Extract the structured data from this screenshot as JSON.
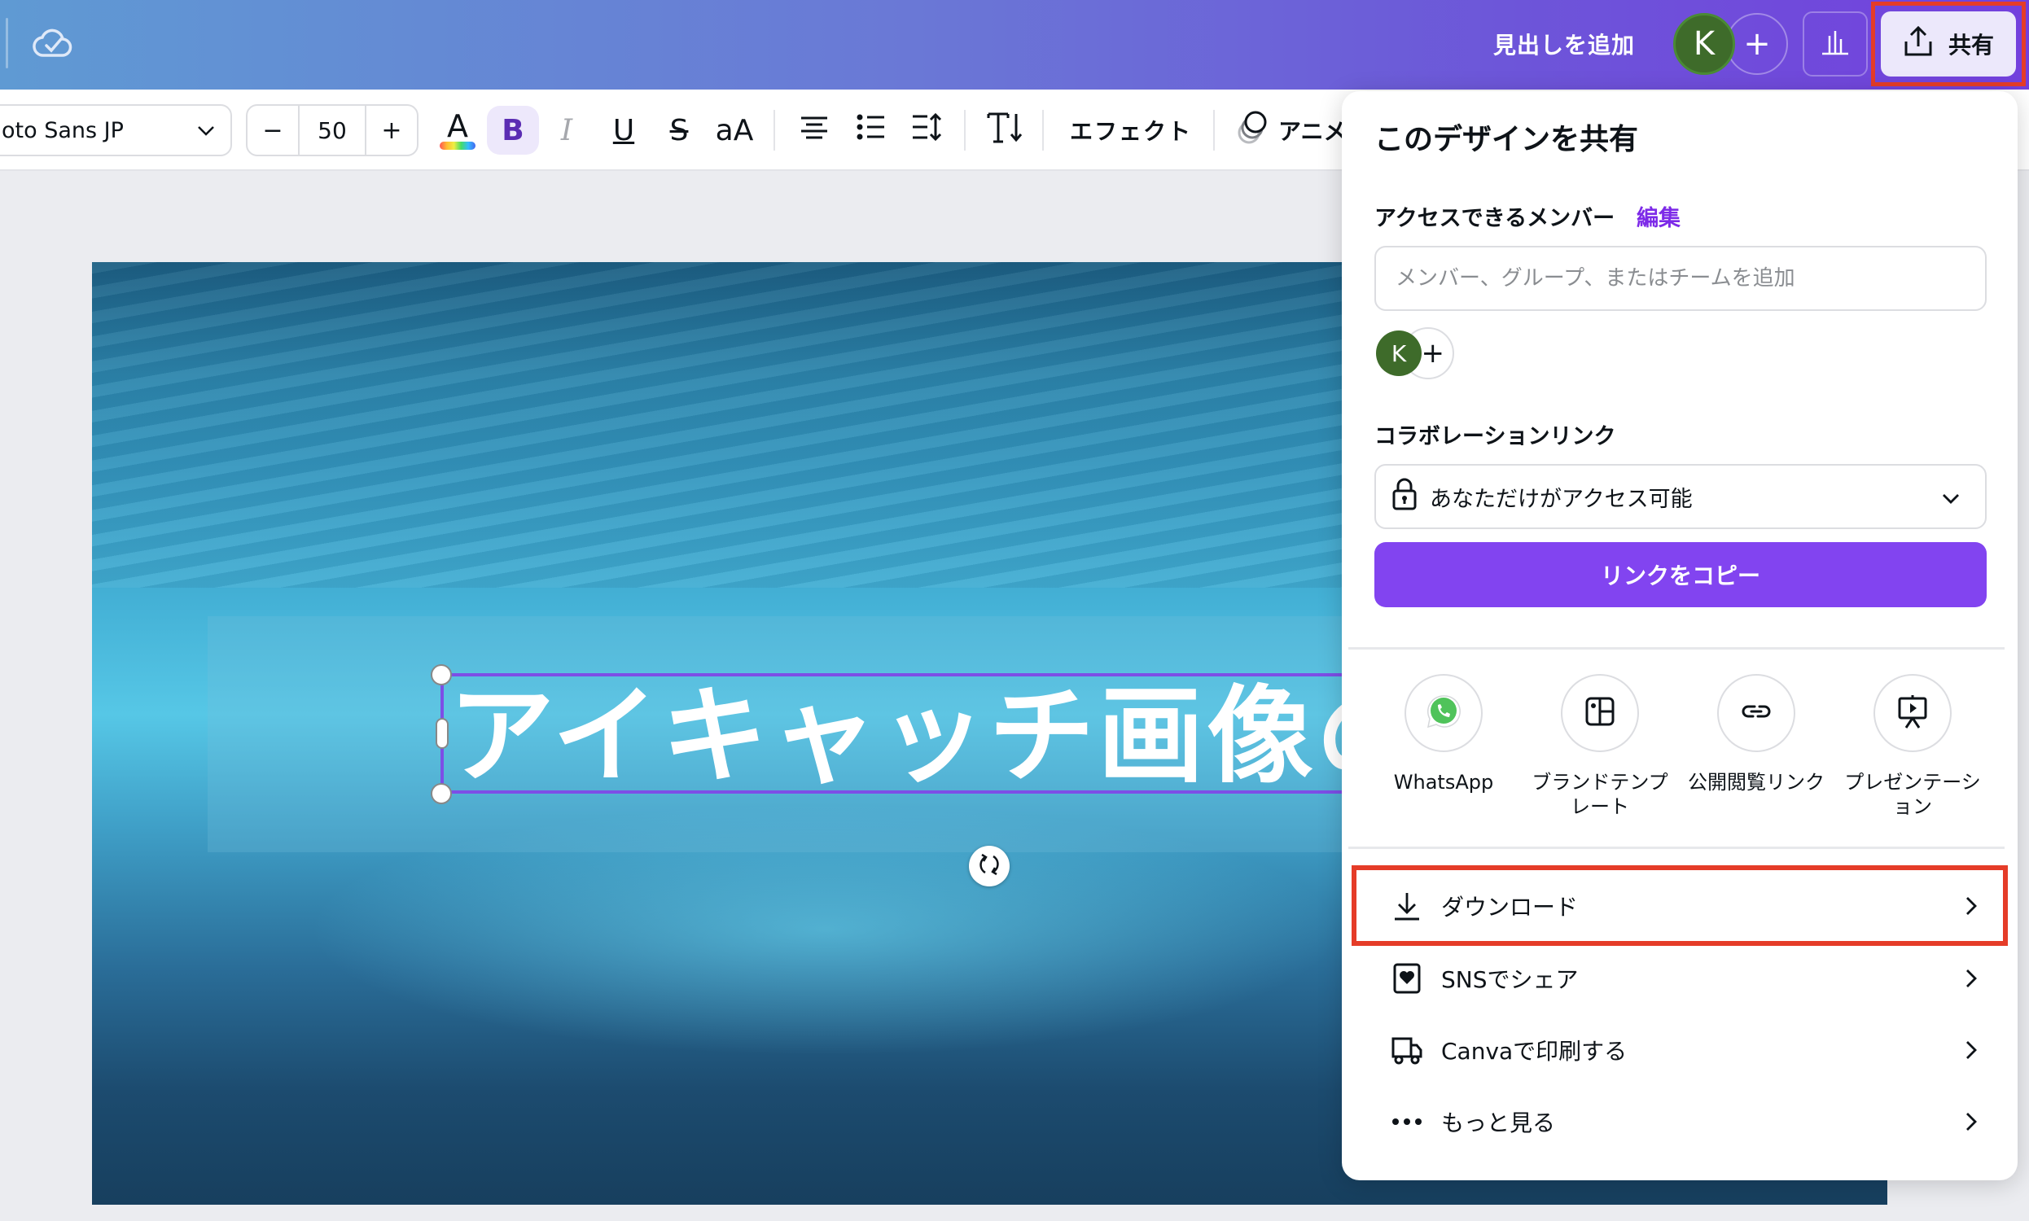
{
  "topbar": {
    "cloud_icon": "cloud-check-icon",
    "add_heading_label": "見出しを追加",
    "avatar_initial": "K",
    "invite_label": "+",
    "insights_icon": "bar-chart-icon",
    "share_label": "共有",
    "colors": {
      "gradient_start": "#5f9ad3",
      "gradient_end": "#7340dd",
      "highlight": "#e53c28"
    }
  },
  "toolbar": {
    "font_name": "Noto Sans JP",
    "font_name_visible": "oto Sans JP",
    "size_decrease": "−",
    "font_size": "50",
    "size_increase": "+",
    "text_color_label": "A",
    "bold_label": "B",
    "italic_label": "I",
    "underline_label": "U",
    "strike_label": "S",
    "case_label": "aA",
    "effects_label": "エフェクト",
    "animate_label": "アニメ"
  },
  "canvas": {
    "headline": "アイキャッチ画像の"
  },
  "share_panel": {
    "title": "このデザインを共有",
    "members_label": "アクセスできるメンバー",
    "edit_link": "編集",
    "member_input_placeholder": "メンバー、グループ、またはチームを追加",
    "member_input_value": "",
    "member_avatar_initial": "K",
    "add_member_label": "+",
    "collab_link_label": "コラボレーションリンク",
    "access_option": "あなただけがアクセス可能",
    "copy_link_label": "リンクをコピー",
    "share_options": [
      {
        "icon": "whatsapp-icon",
        "label": "WhatsApp"
      },
      {
        "icon": "brand-template-icon",
        "label": "ブランドテンプレート"
      },
      {
        "icon": "link-icon",
        "label": "公開閲覧リンク"
      },
      {
        "icon": "presentation-icon",
        "label": "プレゼンテーション"
      }
    ],
    "menu": [
      {
        "icon": "download-icon",
        "label": "ダウンロード",
        "highlighted": true
      },
      {
        "icon": "social-share-icon",
        "label": "SNSでシェア"
      },
      {
        "icon": "truck-icon",
        "label": "Canvaで印刷する"
      },
      {
        "icon": "more-icon",
        "label": "もっと見る"
      }
    ],
    "colors": {
      "accent": "#7d2ae8",
      "button": "#8244f0"
    }
  }
}
